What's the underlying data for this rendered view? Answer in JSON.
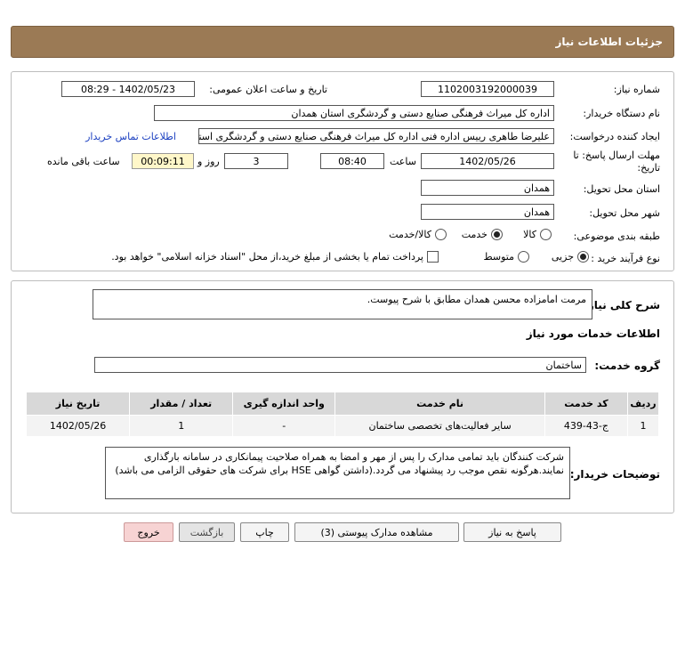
{
  "header": {
    "title": "جزئیات اطلاعات نیاز"
  },
  "info": {
    "need_number_label": "شماره نیاز:",
    "need_number": "1102003192000039",
    "announce_label": "تاریخ و ساعت اعلان عمومی:",
    "announce_value": "1402/05/23 - 08:29",
    "buyer_org_label": "نام دستگاه خریدار:",
    "buyer_org": "اداره کل میراث فرهنگی  صنایع دستی و گردشگری استان همدان",
    "creator_label": "ایجاد کننده درخواست:",
    "creator": "علیرضا طاهری رییس اداره فنی اداره کل میراث فرهنگی  صنایع دستی و گردشگری استان همدان",
    "contact_link": "اطلاعات تماس خریدار",
    "deadline_label_1": "مهلت ارسال پاسخ: تا",
    "deadline_label_2": "تاریخ:",
    "deadline_date": "1402/05/26",
    "time_label": "ساعت",
    "deadline_time": "08:40",
    "days_value": "3",
    "days_label": "روز و",
    "remaining_time": "00:09:11",
    "remaining_label": "ساعت باقی مانده",
    "province_label": "استان محل تحویل:",
    "province": "همدان",
    "city_label": "شهر محل تحویل:",
    "city": "همدان",
    "category_label": "طبقه بندی موضوعی:",
    "category_options": [
      "کالا",
      "خدمت",
      "کالا/خدمت"
    ],
    "category_selected": 1,
    "process_label": "نوع فرآیند خرید :",
    "process_options": [
      "جزیی",
      "متوسط"
    ],
    "process_selected": 0,
    "treasury_note": "پرداخت تمام یا بخشی از مبلغ خرید،از محل \"اسناد خزانه اسلامی\" خواهد بود."
  },
  "summary": {
    "label": "شرح کلی نیاز:",
    "text": "مرمت امامزاده محسن همدان مطابق با شرح پیوست.",
    "services_title": "اطلاعات خدمات مورد نیاز",
    "group_label": "گروه خدمت:",
    "group_value": "ساختمان",
    "table": {
      "headers": [
        "ردیف",
        "کد خدمت",
        "نام خدمت",
        "واحد اندازه گیری",
        "تعداد / مقدار",
        "تاریخ نیاز"
      ],
      "rows": [
        [
          "1",
          "ج-43-439",
          "سایر فعالیت‌های تخصصی ساختمان",
          "-",
          "1",
          "1402/05/26"
        ]
      ]
    },
    "buyer_notes_label": "توضیحات خریدار:",
    "buyer_notes": "شرکت کنندگان باید تمامی مدارک را پس از مهر و امضا به همراه صلاحیت پیمانکاری در سامانه بارگذاری نمایند.هرگونه نقص موجب رد پیشنهاد می گردد.(داشتن گواهی HSE برای شرکت های حقوقی الزامی می باشد)"
  },
  "buttons": {
    "reply": "پاسخ به نیاز",
    "attachments": "مشاهده مدارک پیوستی (3)",
    "print": "چاپ",
    "back": "بازگشت",
    "exit": "خروج"
  },
  "watermark": {
    "line1": "ParsNamadData",
    "line2": "مرکز فرآوری اطلاعات پارس نماد داده",
    "line3": "پایگاه اطلاع رسانی مناقصه و مزایده",
    "line4": "021 88349670",
    "digits": "0101 0001 0101"
  },
  "colors": {
    "header_bg": "#9b7a55",
    "remaining_bg": "#fff7c9",
    "exit_bg": "#f7d3d3",
    "link": "#1a3fc0"
  }
}
